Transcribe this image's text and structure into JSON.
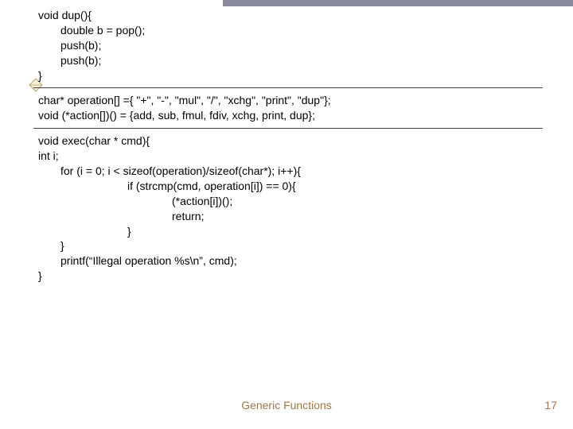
{
  "code": {
    "dup_sig": "void dup(){",
    "dup_l1": "double b = pop();",
    "dup_l2": "push(b);",
    "dup_l3": "push(b);",
    "dup_close": "}",
    "arrays_l1": "char* operation[] ={ \"+\", \"-\", \"mul\", \"/\", \"xchg\", \"print\", \"dup\"};",
    "arrays_l2": "void (*action[])() = {add, sub, fmul, fdiv, xchg, print, dup};",
    "exec_sig": "void exec(char * cmd){",
    "exec_l1": "int i;",
    "exec_l2": "for (i = 0; i < sizeof(operation)/sizeof(char*); i++){",
    "exec_l3": "if (strcmp(cmd, operation[i]) == 0){",
    "exec_l4": "(*action[i])();",
    "exec_l5": "return;",
    "exec_l6": "}",
    "exec_l7": "}",
    "exec_l8": "printf(“Illegal operation %s\\n”, cmd);",
    "exec_close": "}"
  },
  "footer": {
    "title": "Generic Functions",
    "page": "17"
  }
}
